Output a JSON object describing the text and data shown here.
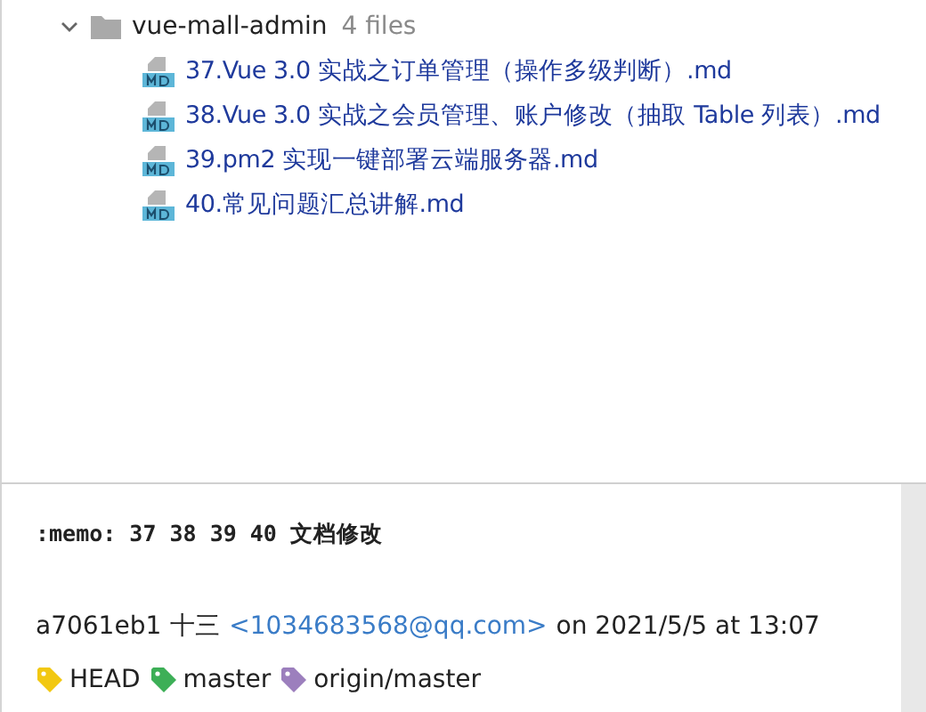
{
  "tree": {
    "folder": {
      "name": "vue-mall-admin",
      "count": "4 files",
      "expanded": true
    },
    "files": [
      {
        "name": "37.Vue 3.0 实战之订单管理（操作多级判断）.md"
      },
      {
        "name": "38.Vue 3.0 实战之会员管理、账户修改（抽取 Table 列表）.md"
      },
      {
        "name": "39.pm2 实现一键部署云端服务器.md"
      },
      {
        "name": "40.常见问题汇总讲解.md"
      }
    ]
  },
  "commit": {
    "message": ":memo: 37 38 39 40 文档修改",
    "hash": "a7061eb1",
    "author": "十三",
    "email": "<1034683568@qq.com>",
    "date": "on 2021/5/5 at 13:07",
    "refs": [
      {
        "name": "HEAD",
        "color": "#f2c811"
      },
      {
        "name": "master",
        "color": "#3daf57"
      },
      {
        "name": "origin/master",
        "color": "#9c7fbd"
      }
    ]
  }
}
